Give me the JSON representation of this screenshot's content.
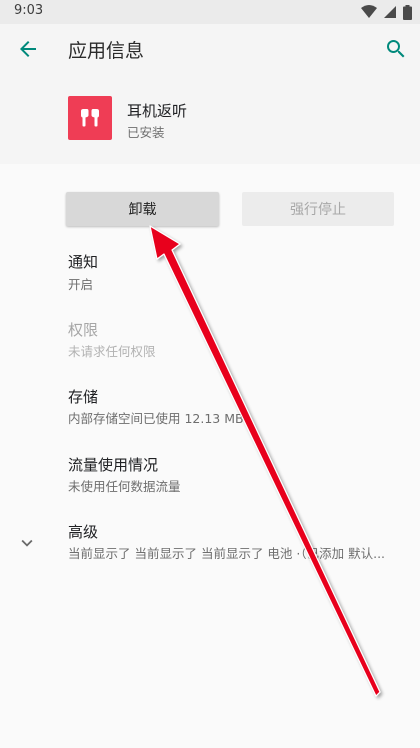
{
  "status_bar": {
    "time": "9:03",
    "icons": [
      "wifi-icon",
      "signal-icon",
      "battery-icon"
    ]
  },
  "app_bar": {
    "title": "应用信息",
    "back_icon": "arrow-back-icon",
    "search_icon": "search-icon"
  },
  "app": {
    "name": "耳机返听",
    "status": "已安装",
    "icon": "earbuds-icon",
    "icon_color": "#ef3d55"
  },
  "actions": {
    "uninstall_label": "卸载",
    "force_stop_label": "强行停止"
  },
  "prefs": {
    "notifications": {
      "title": "通知",
      "summary": "开启"
    },
    "permissions": {
      "title": "权限",
      "summary": "未请求任何权限"
    },
    "storage": {
      "title": "存储",
      "summary": "内部存储空间已使用 12.13 MB"
    },
    "data_usage": {
      "title": "流量使用情况",
      "summary": "未使用任何数据流量"
    },
    "advanced": {
      "title": "高级",
      "summary": "当前显示了 当前显示了 当前显示了 电池 ·（已添加 默认..."
    }
  },
  "colors": {
    "accent": "#00897b",
    "annotation_arrow": "#e8001f"
  }
}
